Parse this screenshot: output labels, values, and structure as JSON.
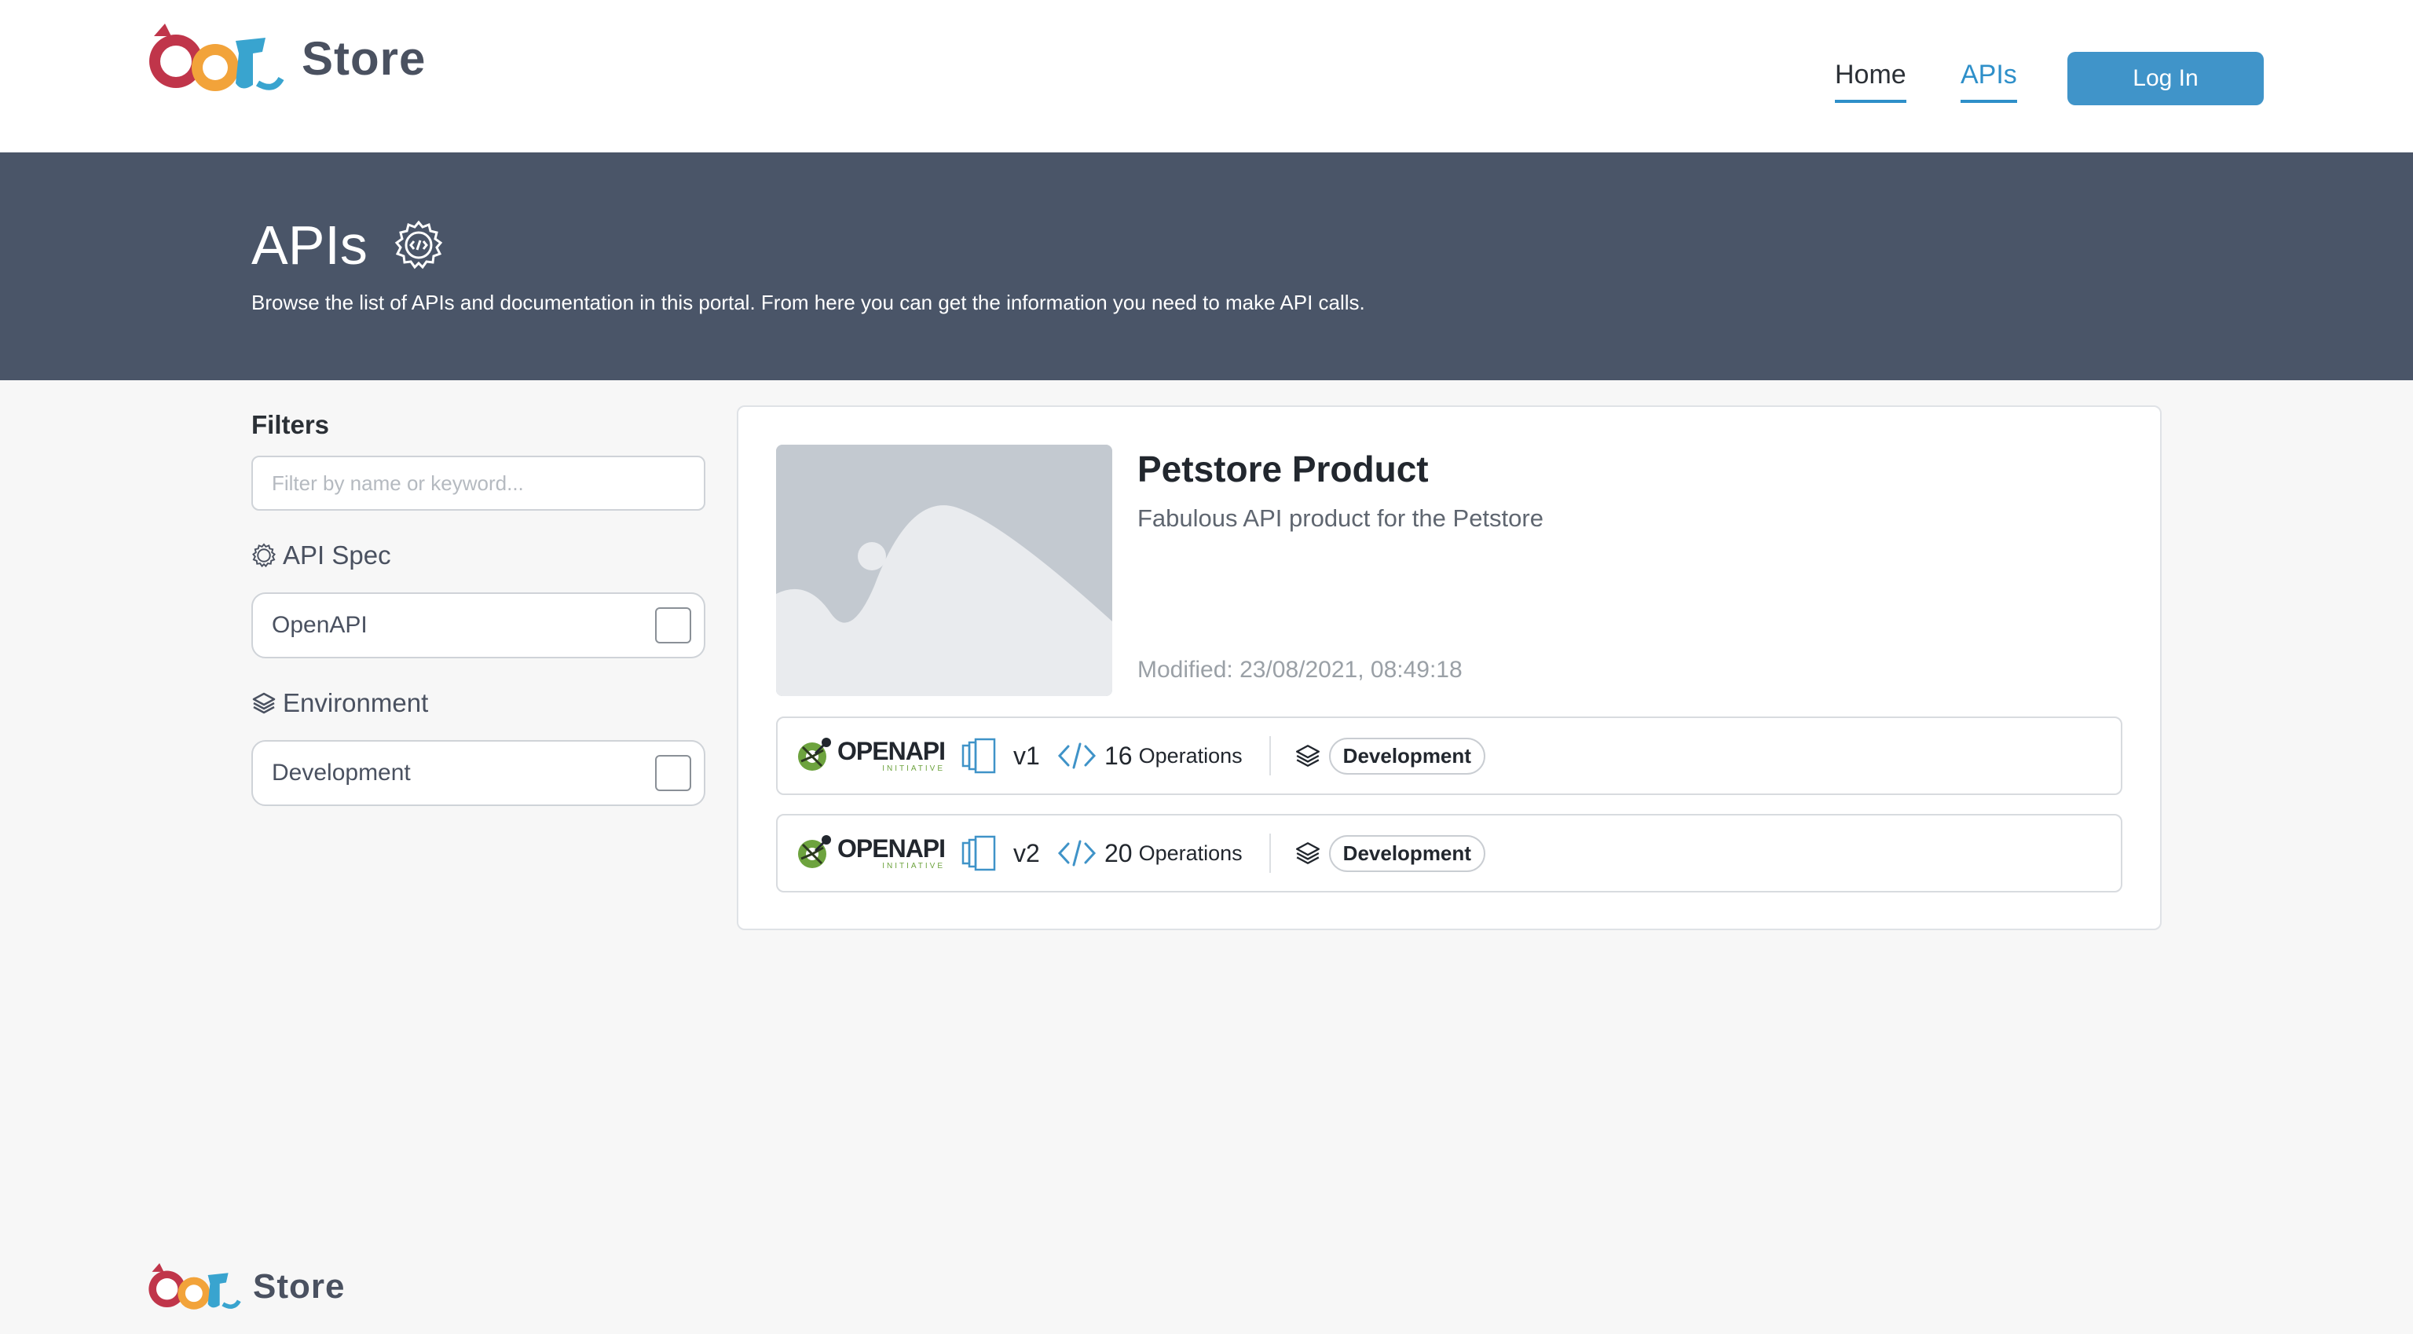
{
  "brand": {
    "name": "Store"
  },
  "nav": {
    "home": "Home",
    "apis": "APIs",
    "login": "Log In"
  },
  "hero": {
    "title": "APIs",
    "description": "Browse the list of APIs and documentation in this portal. From here you can get the information you need to make API calls."
  },
  "filters": {
    "title": "Filters",
    "search_placeholder": "Filter by name or keyword...",
    "api_spec": {
      "heading": "API Spec",
      "options": [
        "OpenAPI"
      ]
    },
    "environment": {
      "heading": "Environment",
      "options": [
        "Development"
      ]
    }
  },
  "products": [
    {
      "title": "Petstore Product",
      "description": "Fabulous API product for the Petstore",
      "modified": "Modified: 23/08/2021, 08:49:18",
      "versions": [
        {
          "spec_logo": "OPENAPI",
          "spec_sub": "INITIATIVE",
          "version": "v1",
          "ops_count": "16",
          "ops_label": "Operations",
          "environment": "Development"
        },
        {
          "spec_logo": "OPENAPI",
          "spec_sub": "INITIATIVE",
          "version": "v2",
          "ops_count": "20",
          "ops_label": "Operations",
          "environment": "Development"
        }
      ]
    }
  ],
  "colors": {
    "accent": "#2e8fc9",
    "button": "#4094c9",
    "hero_bg": "#4a5568",
    "page_bg": "#f7f7f7"
  },
  "icons": [
    "pet-logo-icon",
    "gear-code-icon",
    "layers-icon",
    "openapi-icon",
    "versions-icon",
    "code-icon",
    "image-placeholder-icon"
  ]
}
